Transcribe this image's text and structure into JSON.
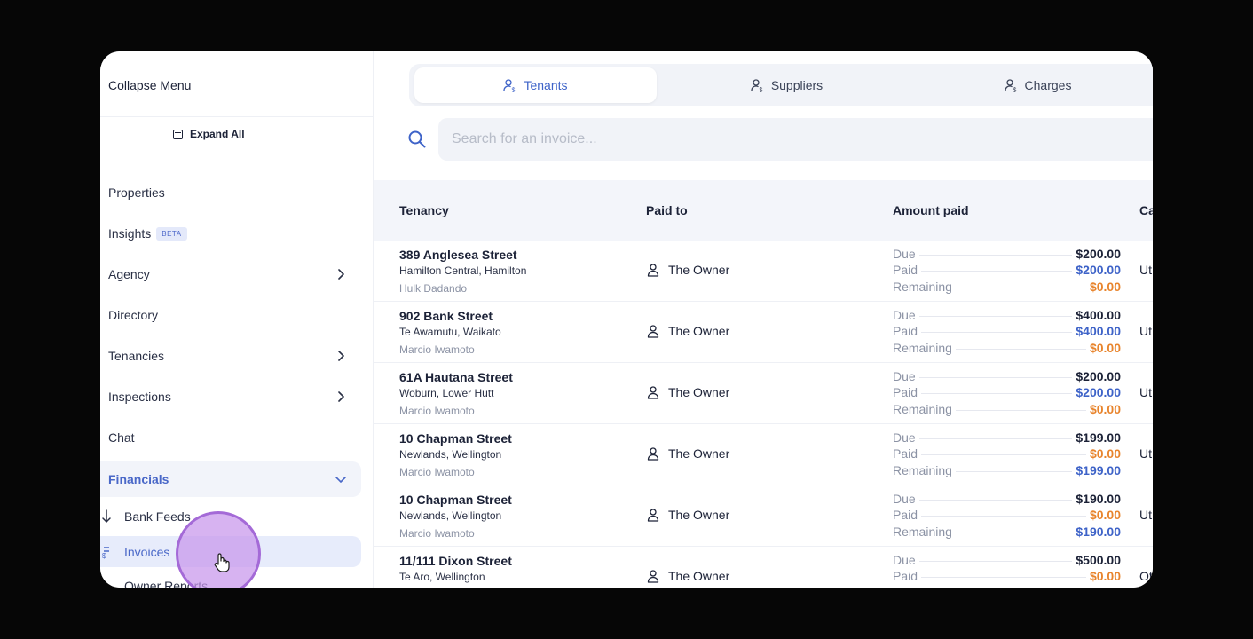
{
  "sidebar": {
    "collapse_label": "Collapse Menu",
    "expand_label": "Expand All",
    "items": [
      {
        "label": "Properties"
      },
      {
        "label": "Insights",
        "badge": "BETA"
      },
      {
        "label": "Agency"
      },
      {
        "label": "Directory"
      },
      {
        "label": "Tenancies"
      },
      {
        "label": "Inspections"
      },
      {
        "label": "Chat"
      },
      {
        "label": "Financials"
      }
    ],
    "sub_items": [
      {
        "label": "Bank Feeds"
      },
      {
        "label": "Invoices"
      },
      {
        "label": "Owner Reports"
      }
    ]
  },
  "tabs": [
    {
      "label": "Tenants"
    },
    {
      "label": "Suppliers"
    },
    {
      "label": "Charges"
    }
  ],
  "search": {
    "placeholder": "Search for an invoice..."
  },
  "table": {
    "headers": [
      "Tenancy",
      "Paid to",
      "Amount paid",
      "Ca"
    ],
    "amount_labels": {
      "due": "Due",
      "paid": "Paid",
      "remaining": "Remaining"
    },
    "rows": [
      {
        "address": "389 Anglesea Street",
        "suburb": "Hamilton Central, Hamilton",
        "tenant": "Hulk Dadando",
        "paid_to": "The Owner",
        "due": "$200.00",
        "paid": "$200.00",
        "remaining": "$0.00",
        "category": "Ut"
      },
      {
        "address": "902 Bank Street",
        "suburb": "Te Awamutu, Waikato",
        "tenant": "Marcio Iwamoto",
        "paid_to": "The Owner",
        "due": "$400.00",
        "paid": "$400.00",
        "remaining": "$0.00",
        "category": "Ut"
      },
      {
        "address": "61A Hautana Street",
        "suburb": "Woburn, Lower Hutt",
        "tenant": "Marcio Iwamoto",
        "paid_to": "The Owner",
        "due": "$200.00",
        "paid": "$200.00",
        "remaining": "$0.00",
        "category": "Ut"
      },
      {
        "address": "10 Chapman Street",
        "suburb": "Newlands, Wellington",
        "tenant": "Marcio Iwamoto",
        "paid_to": "The Owner",
        "due": "$199.00",
        "paid": "$0.00",
        "remaining": "$199.00",
        "category": "Ut"
      },
      {
        "address": "10 Chapman Street",
        "suburb": "Newlands, Wellington",
        "tenant": "Marcio Iwamoto",
        "paid_to": "The Owner",
        "due": "$190.00",
        "paid": "$0.00",
        "remaining": "$190.00",
        "category": "Ut"
      },
      {
        "address": "11/111 Dixon Street",
        "suburb": "Te Aro, Wellington",
        "tenant": "",
        "paid_to": "The Owner",
        "due": "$500.00",
        "paid": "$0.00",
        "remaining": "",
        "category": "Ot"
      }
    ]
  },
  "colors": {
    "accent": "#3e63c8",
    "orange": "#e8842c",
    "text": "#1c2237",
    "muted": "#8c93a5"
  }
}
